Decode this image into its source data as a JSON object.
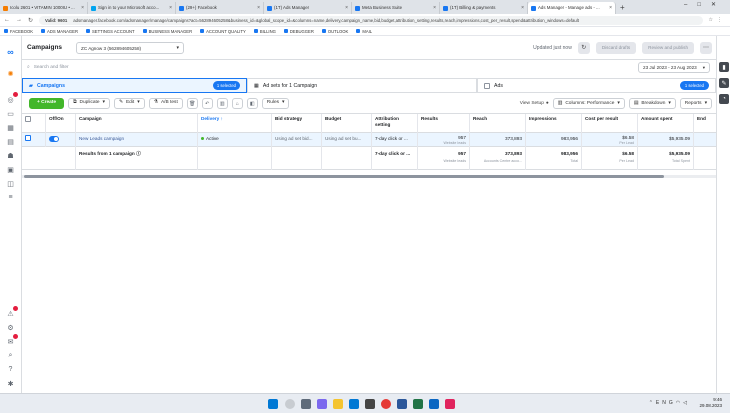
{
  "browser": {
    "tabs": [
      {
        "title": "Icolu 2601 • VITAMIN 1000IU • ...",
        "color": "#f57c00"
      },
      {
        "title": "Sign in to your Microsoft acco...",
        "color": "#00a4ef"
      },
      {
        "title": "(29+) Facebook",
        "color": "#1877f2"
      },
      {
        "title": "(1T) Ads Manager",
        "color": "#1877f2"
      },
      {
        "title": "Meta Business Suite",
        "color": "#1877f2"
      },
      {
        "title": "(1T) Billing & payments",
        "color": "#1877f2"
      },
      {
        "title": "Ads Manager - Manage ads - ...",
        "color": "#1877f2"
      }
    ],
    "new_tab": "+",
    "url": "adsmanager.facebook.com/adsmanager/manage/campaigns?act=562894605258&business_id=&global_scope_id=&columns=name,delivery,campaign_name,bid,budget,attribution_setting,results,reach,impressions,cost_per_result,spend&attribution_windows=default",
    "url_label": "Valid: 9601",
    "bookmarks": [
      "FACEBOOK",
      "ADS MANAGER",
      "SETTINGS ACCOUNT",
      "BUSINESS MANAGER",
      "ACCOUNT QUALITY",
      "BILLING",
      "DEBUGGER",
      "OUTLOOK",
      "MAIL"
    ]
  },
  "header": {
    "title": "Campaigns",
    "account": "ZC Agnow 3 (562894605258)",
    "updated": "Updated just now",
    "discard": "Discard drafts",
    "review": "Review and publish"
  },
  "search": {
    "placeholder": "Search and filter",
    "date_range": "23 Jul 2023 - 23 Aug 2023"
  },
  "levels": {
    "campaigns": "Campaigns",
    "campaigns_badge": "1 selected",
    "adsets": "Ad sets for 1 Campaign",
    "ads": "Ads",
    "ads_badge": "1 selected"
  },
  "toolbar": {
    "create": "+ Create",
    "duplicate": "Duplicate",
    "edit": "Edit",
    "ab_test": "A/B test",
    "rules": "Rules",
    "view_setup": "View Setup",
    "columns": "Columns: Performance",
    "breakdown": "Breakdown",
    "reports": "Reports"
  },
  "table": {
    "headers": [
      {
        "key": "offon",
        "label": "Off/On"
      },
      {
        "key": "campaign",
        "label": "Campaign"
      },
      {
        "key": "delivery",
        "label": "Delivery ↑"
      },
      {
        "key": "bid",
        "label": "Bid strategy"
      },
      {
        "key": "budget",
        "label": "Budget"
      },
      {
        "key": "attr",
        "label": "Attribution setting"
      },
      {
        "key": "results",
        "label": "Results"
      },
      {
        "key": "reach",
        "label": "Reach"
      },
      {
        "key": "impr",
        "label": "Impressions"
      },
      {
        "key": "cpr",
        "label": "Cost per result"
      },
      {
        "key": "spent",
        "label": "Amount spent"
      },
      {
        "key": "ends",
        "label": "End"
      }
    ],
    "campaign_row": {
      "name": "New Leads campaign",
      "delivery": "Active",
      "bid": "Using ad set bid...",
      "budget": "Using ad set bu...",
      "attr": "7-day click or ...",
      "results": "957",
      "results_sub": "Website leads",
      "reach": "373,893",
      "impr": "983,956",
      "cpr": "$6.58",
      "cpr_sub": "Per Lead",
      "spent": "$5,935.09",
      "ends": ""
    },
    "total_row": {
      "label": "Results from 1 campaign",
      "attr": "7-day click or ...",
      "results": "957",
      "results_sub": "Website leads",
      "reach": "373,893",
      "reach_sub": "Accounts Centre acco...",
      "impr": "983,956",
      "impr_sub": "Total",
      "cpr": "$6.58",
      "cpr_sub": "Per Lead",
      "spent": "$5,935.09",
      "spent_sub": "Total Spent"
    }
  },
  "taskbar": {
    "lang": "ENG",
    "time": "9:46",
    "date": "29.08.2023"
  },
  "colors": {
    "accent": "#1877f2",
    "create": "#42b72a"
  }
}
